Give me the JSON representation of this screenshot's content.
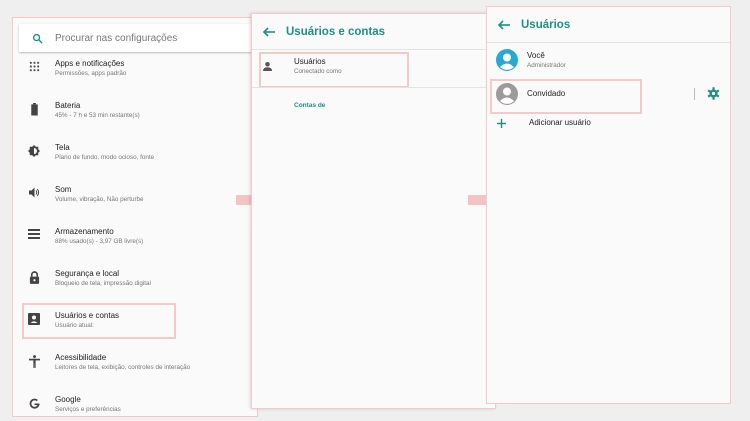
{
  "colors": {
    "accent": "#1e8f84",
    "highlight": "#f4c9c9",
    "arrow": "#f4c3c3"
  },
  "settings": {
    "search_placeholder": "Procurar nas configurações",
    "items": [
      {
        "title": "Apps e notificações",
        "subtitle": "Permissões, apps padrão",
        "icon": "apps-grid-icon"
      },
      {
        "title": "Bateria",
        "subtitle": "45% - 7 h e 53 min restante(s)",
        "icon": "battery-icon"
      },
      {
        "title": "Tela",
        "subtitle": "Plano de fundo, modo ocioso, fonte",
        "icon": "brightness-icon"
      },
      {
        "title": "Som",
        "subtitle": "Volume, vibração, Não perturbe",
        "icon": "volume-icon"
      },
      {
        "title": "Armazenamento",
        "subtitle": "88% usado(s) - 3,97 GB livre(s)",
        "icon": "storage-icon"
      },
      {
        "title": "Segurança e local",
        "subtitle": "Bloqueio de tela, impressão digital",
        "icon": "lock-icon"
      },
      {
        "title": "Usuários e contas",
        "subtitle": "Usuário atual:",
        "icon": "account-box-icon"
      },
      {
        "title": "Acessibilidade",
        "subtitle": "Leitores de tela, exibição, controles de interação",
        "icon": "accessibility-icon"
      },
      {
        "title": "Google",
        "subtitle": "Serviços e preferências",
        "icon": "google-icon"
      }
    ]
  },
  "accounts": {
    "title": "Usuários e contas",
    "users_title": "Usuários",
    "users_subtitle": "Conectado como",
    "section_label": "Contas de"
  },
  "users": {
    "title": "Usuários",
    "you_title": "Você",
    "you_subtitle": "Administrador",
    "guest_title": "Convidado",
    "add_label": "Adicionar usuário"
  }
}
